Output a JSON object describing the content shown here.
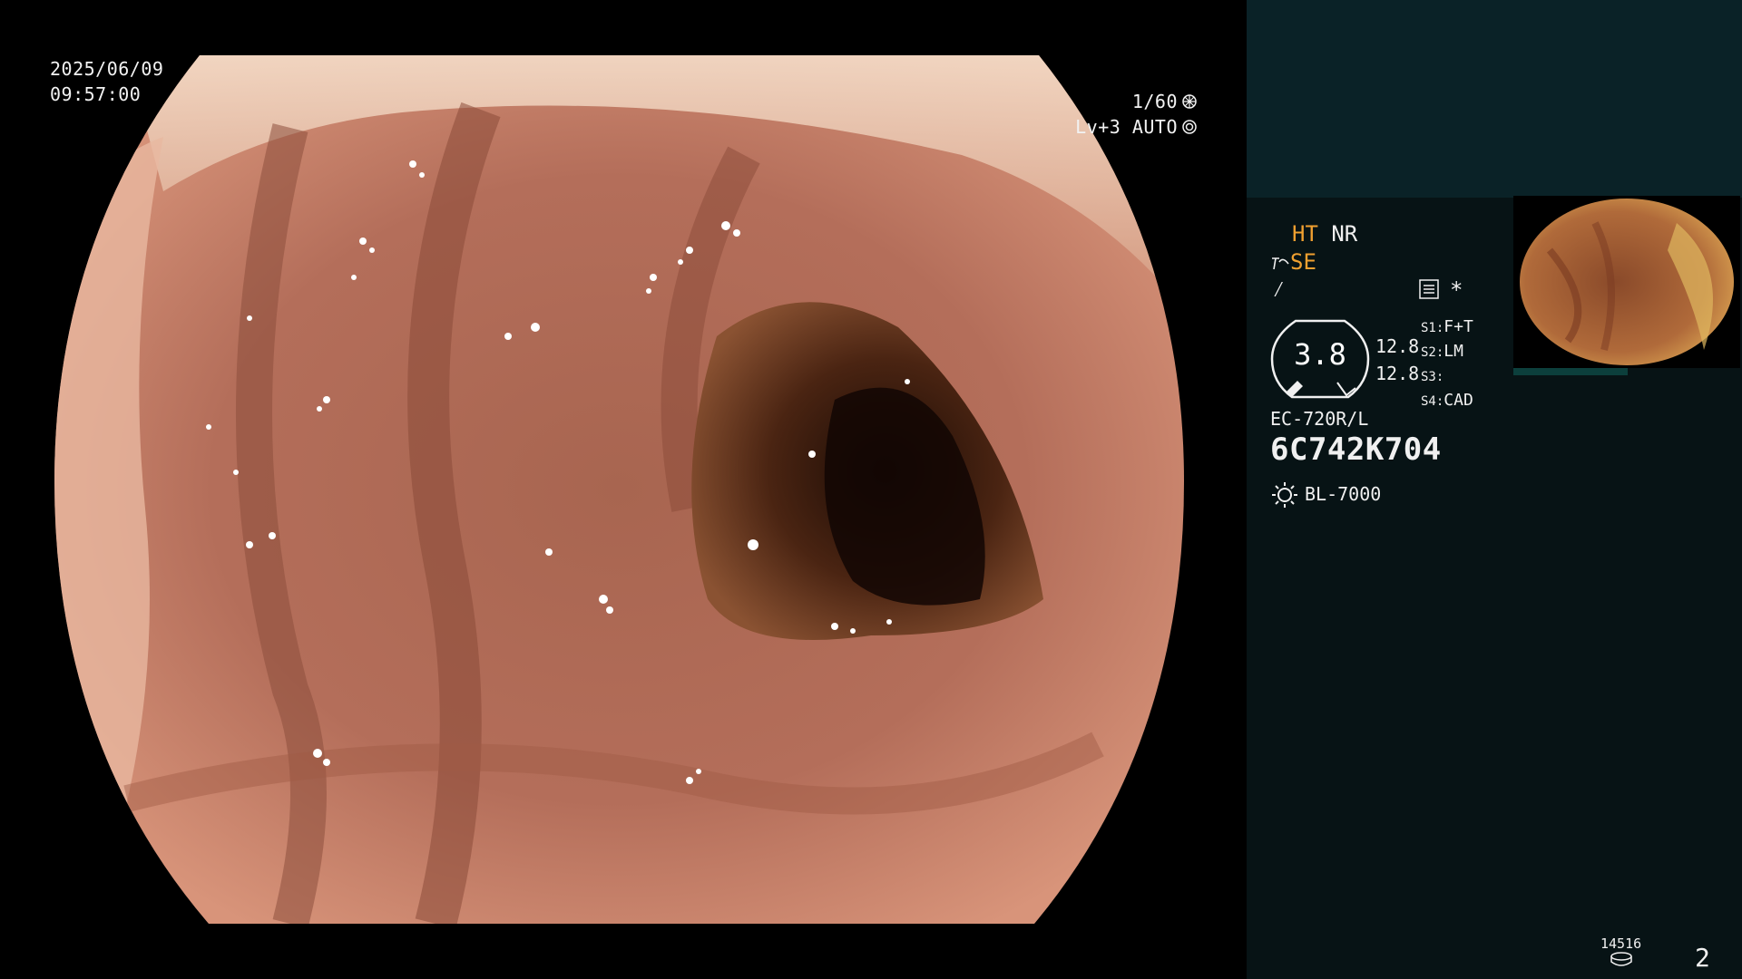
{
  "overlay": {
    "date": "2025/06/09",
    "time": "09:57:00",
    "shutter": "1/60",
    "level": "Lv+3 AUTO"
  },
  "modes": {
    "ht": "HT",
    "nr": "NR",
    "se": "SE",
    "f_symbol": "⁄"
  },
  "gauge": {
    "value": "3.8",
    "val_a": "12.8",
    "val_b": "12.8"
  },
  "switches": [
    {
      "label": "S1:",
      "value": "F+T"
    },
    {
      "label": "S2:",
      "value": "LM"
    },
    {
      "label": "S3:",
      "value": ""
    },
    {
      "label": "S4:",
      "value": "CAD"
    }
  ],
  "scope": {
    "model": "EC-720R/L",
    "serial": "6C742K704"
  },
  "light_source": "BL-7000",
  "star": "*",
  "frame_count": "14516",
  "page_number": "2",
  "colors": {
    "accent_orange": "#f0a030",
    "panel_top": "#0a2227",
    "panel": "#071315"
  }
}
